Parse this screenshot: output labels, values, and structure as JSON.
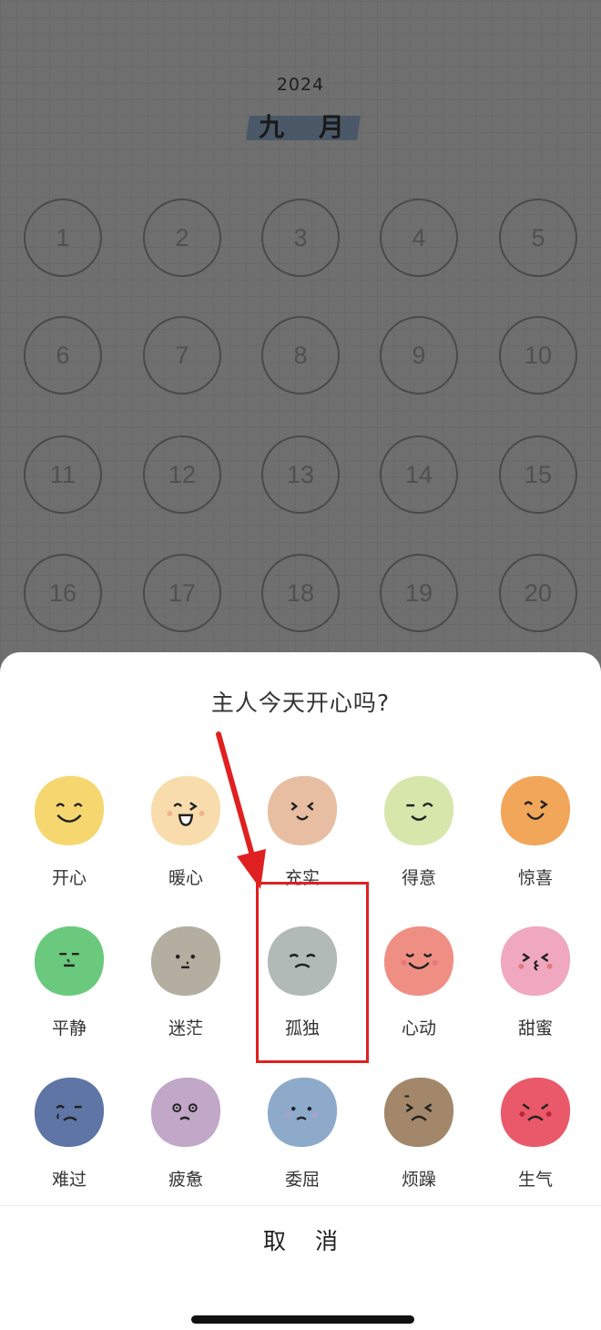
{
  "calendar": {
    "year": "2024",
    "month": "九 月",
    "days": [
      "1",
      "2",
      "3",
      "4",
      "5",
      "6",
      "7",
      "8",
      "9",
      "10",
      "11",
      "12",
      "13",
      "14",
      "15",
      "16",
      "17",
      "18",
      "19",
      "20"
    ]
  },
  "sheet": {
    "question": "主人今天开心吗?",
    "moods": [
      {
        "label": "开心",
        "color": "#f6d66f",
        "icon": "happy-face-icon"
      },
      {
        "label": "暖心",
        "color": "#f8dcab",
        "icon": "warm-face-icon"
      },
      {
        "label": "充实",
        "color": "#e8bea2",
        "icon": "fulfilled-face-icon"
      },
      {
        "label": "得意",
        "color": "#d7e6ab",
        "icon": "proud-face-icon"
      },
      {
        "label": "惊喜",
        "color": "#f1a65a",
        "icon": "surprised-face-icon"
      },
      {
        "label": "平静",
        "color": "#6bc97d",
        "icon": "calm-face-icon"
      },
      {
        "label": "迷茫",
        "color": "#b3aea0",
        "icon": "confused-face-icon"
      },
      {
        "label": "孤独",
        "color": "#b1bab6",
        "icon": "lonely-face-icon"
      },
      {
        "label": "心动",
        "color": "#ef8f84",
        "icon": "heartbeat-face-icon"
      },
      {
        "label": "甜蜜",
        "color": "#f0a7c0",
        "icon": "sweet-face-icon"
      },
      {
        "label": "难过",
        "color": "#5e75a5",
        "icon": "sad-face-icon"
      },
      {
        "label": "疲惫",
        "color": "#c1a7c8",
        "icon": "tired-face-icon"
      },
      {
        "label": "委屈",
        "color": "#8eaacb",
        "icon": "wronged-face-icon"
      },
      {
        "label": "烦躁",
        "color": "#a3876a",
        "icon": "irritated-face-icon"
      },
      {
        "label": "生气",
        "color": "#e9596a",
        "icon": "angry-face-icon"
      }
    ],
    "cancel_label": "取 消"
  },
  "colors": {
    "highlight": "#e02020",
    "arrow": "#e02020"
  }
}
